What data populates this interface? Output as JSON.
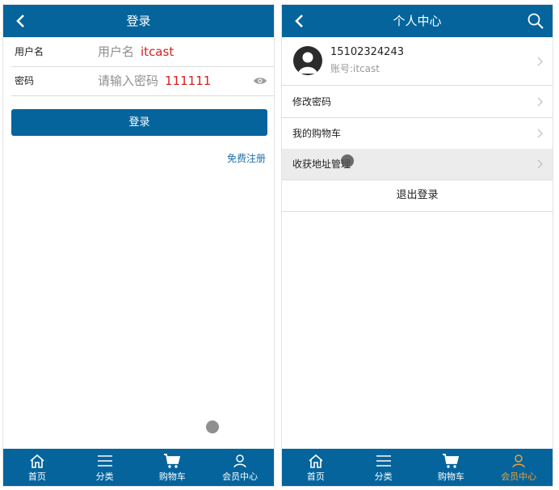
{
  "login": {
    "title": "登录",
    "username_label": "用户名",
    "username_placeholder": "用户名",
    "username_value": "itcast",
    "password_label": "密码",
    "password_placeholder": "请输入密码",
    "password_value": "111111",
    "login_button": "登录",
    "register_link": "免费注册"
  },
  "member": {
    "title": "个人中心",
    "phone": "15102324243",
    "account": "账号:itcast",
    "menu": [
      "修改密码",
      "我的购物车",
      "收获地址管理"
    ],
    "logout": "退出登录"
  },
  "tabbar": {
    "items": [
      {
        "label": "首页",
        "icon": "home-icon"
      },
      {
        "label": "分类",
        "icon": "menu-icon"
      },
      {
        "label": "购物车",
        "icon": "cart-icon"
      },
      {
        "label": "会员中心",
        "icon": "user-icon"
      }
    ]
  },
  "colors": {
    "brand": "#05649c",
    "active_tab": "#f0a030",
    "input_value": "#d42020",
    "link": "#1f6fab"
  }
}
